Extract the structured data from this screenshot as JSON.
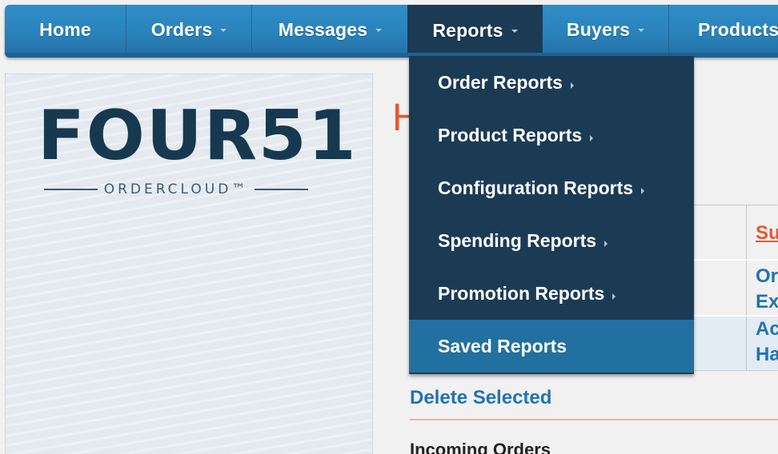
{
  "nav": {
    "items": [
      {
        "label": "Home"
      },
      {
        "label": "Orders"
      },
      {
        "label": "Messages"
      },
      {
        "label": "Reports"
      },
      {
        "label": "Buyers"
      },
      {
        "label": "Products"
      }
    ]
  },
  "logo": {
    "main": "FOUR51",
    "sub": "ORDERCLOUD™"
  },
  "dropdown": {
    "items": [
      {
        "label": "Order Reports"
      },
      {
        "label": "Product Reports"
      },
      {
        "label": "Configuration Reports"
      },
      {
        "label": "Spending Reports"
      },
      {
        "label": "Promotion Reports"
      },
      {
        "label": "Saved Reports"
      }
    ]
  },
  "main": {
    "heading_fragment": "H",
    "table": {
      "header_fragment": "Su",
      "row1_line1": "Or",
      "row1_line2": "Ex",
      "row2_line1": "Ac",
      "row2_line2": "Ha"
    },
    "delete_selected": "Delete Selected",
    "incoming_orders": "Incoming Orders"
  },
  "colors": {
    "nav_bg": "#2a82bb",
    "dropdown_bg": "#1b3b55",
    "highlight": "#21709f",
    "accent_orange": "#e7582c",
    "link_blue": "#2273b3"
  }
}
